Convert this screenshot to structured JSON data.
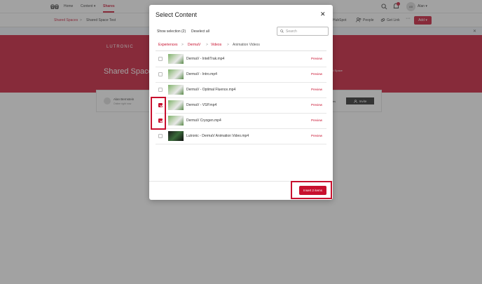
{
  "nav": {
    "home": "Home",
    "content": "Content ▾",
    "shares": "Shares",
    "avatar_initials": "AB",
    "user": "Alan ▾"
  },
  "subbar": {
    "crumb_1": "Shared Spaces",
    "crumb_sep": ">",
    "crumb_2": "Shared Space Test",
    "hubspot": "HubSpot",
    "people": "People",
    "get_link": "Get Link",
    "more": "···",
    "add": "Add ▾"
  },
  "hero": {
    "brand": "LUTRONIC",
    "title": "Shared Space",
    "right": "ed Space"
  },
  "card": {
    "name": "Alan Bernstein",
    "subtitle": "Online right now",
    "tiles": "tiles",
    "invite": "Invite"
  },
  "modal": {
    "title": "Select Content",
    "close": "✕",
    "show_selection": "Show selection (2)",
    "deselect_all": "Deselect all",
    "search_placeholder": "Search",
    "path": [
      "Experiences",
      "DermaV",
      "Videos",
      "Animation Videos"
    ],
    "path_sep": ">",
    "items": [
      {
        "name": "DermaV - InteliTrak.mp4",
        "checked": false,
        "preview": "Preview"
      },
      {
        "name": "DermaV - Intro.mp4",
        "checked": false,
        "preview": "Preview"
      },
      {
        "name": "DermaV - Optimal Fluence.mp4",
        "checked": false,
        "preview": "Preview"
      },
      {
        "name": "DermaV - VSP.mp4",
        "checked": true,
        "preview": "Preview"
      },
      {
        "name": "DermaV Cryogen.mp4",
        "checked": true,
        "preview": "Preview"
      },
      {
        "name": "Lutronic - DermaV Animation Video.mp4",
        "checked": false,
        "preview": "Preview"
      }
    ],
    "insert_label": "Insert 2 items"
  },
  "colors": {
    "accent": "#c8102e"
  }
}
